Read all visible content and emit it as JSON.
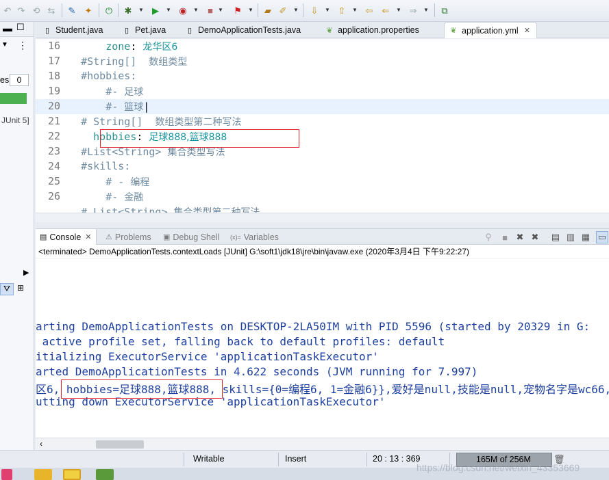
{
  "editor_tabs": [
    {
      "label": "Student.java",
      "icon": "java-file-icon",
      "active": false
    },
    {
      "label": "Pet.java",
      "icon": "java-file-icon",
      "active": false
    },
    {
      "label": "DemoApplicationTests.java",
      "icon": "java-file-icon",
      "active": false
    },
    {
      "label": "application.properties",
      "icon": "leaf-icon",
      "active": false
    },
    {
      "label": "application.yml",
      "icon": "leaf-icon",
      "active": true,
      "close": "✕"
    }
  ],
  "editor_lines": [
    {
      "num": "16",
      "indent": "      ",
      "parts": [
        {
          "t": "zone",
          "c": "k"
        },
        {
          "t": ": "
        },
        {
          "t": "龙华区6",
          "c": "v cjk"
        }
      ]
    },
    {
      "num": "17",
      "indent": "  ",
      "parts": [
        {
          "t": "#String[]  ",
          "c": "c"
        },
        {
          "t": "数组类型",
          "c": "c cjk"
        }
      ]
    },
    {
      "num": "18",
      "indent": "  ",
      "parts": [
        {
          "t": "#hobbies:",
          "c": "c"
        }
      ]
    },
    {
      "num": "19",
      "indent": "      ",
      "parts": [
        {
          "t": "#- ",
          "c": "c"
        },
        {
          "t": "足球",
          "c": "c cjk"
        }
      ]
    },
    {
      "num": "20",
      "indent": "      ",
      "parts": [
        {
          "t": "#- ",
          "c": "c"
        },
        {
          "t": "篮球",
          "c": "c cjk"
        },
        {
          "t": "|",
          "c": ""
        }
      ],
      "current": true
    },
    {
      "num": "21",
      "indent": "  ",
      "parts": [
        {
          "t": "# String[]  ",
          "c": "c"
        },
        {
          "t": "数组类型第二种写法",
          "c": "c cjk"
        }
      ]
    },
    {
      "num": "22",
      "indent": "    ",
      "parts": [
        {
          "t": "hobbies",
          "c": "k"
        },
        {
          "t": ": "
        },
        {
          "t": "足球888,篮球888",
          "c": "v cjk"
        }
      ]
    },
    {
      "num": "23",
      "indent": "  ",
      "parts": [
        {
          "t": "#List<String> ",
          "c": "c"
        },
        {
          "t": "集合类型写法",
          "c": "c cjk"
        }
      ]
    },
    {
      "num": "24",
      "indent": "  ",
      "parts": [
        {
          "t": "#skills:",
          "c": "c"
        }
      ]
    },
    {
      "num": "25",
      "indent": "      ",
      "parts": [
        {
          "t": "# - ",
          "c": "c"
        },
        {
          "t": "编程",
          "c": "c cjk"
        }
      ]
    },
    {
      "num": "26",
      "indent": "      ",
      "parts": [
        {
          "t": "#- ",
          "c": "c"
        },
        {
          "t": "金融",
          "c": "c cjk"
        }
      ]
    },
    {
      "num": "",
      "indent": "  ",
      "parts": [
        {
          "t": "# List<String> ",
          "c": "c"
        },
        {
          "t": "集合类型第二种写法",
          "c": "c cjk"
        }
      ]
    }
  ],
  "console_tabs": [
    {
      "label": "Console",
      "active": true,
      "icon": "console-icon",
      "close": "✕"
    },
    {
      "label": "Problems",
      "active": false,
      "icon": "problems-icon"
    },
    {
      "label": "Debug Shell",
      "active": false,
      "icon": "debug-shell-icon"
    },
    {
      "label": "Variables",
      "active": false,
      "icon": "variables-icon",
      "prefix": "(x)="
    }
  ],
  "console_status": "<terminated> DemoApplicationTests.contextLoads [JUnit] G:\\soft1\\jdk18\\jre\\bin\\javaw.exe (2020年3月4日 下午9:22:27)",
  "console_lines": [
    "arting DemoApplicationTests on DESKTOP-2LA50IM with PID 5596 (started by 20329 in G:",
    " active profile set, falling back to default profiles: default",
    "itializing ExecutorService 'applicationTaskExecutor'",
    "arted DemoApplicationTests in 4.622 seconds (JVM running for 7.997)",
    "区6, hobbies=足球888,篮球888, skills={0=编程6, 1=金融6}},爱好是null,技能是null,宠物名字是wc66,",
    "utting down ExecutorService 'applicationTaskExecutor'"
  ],
  "left_panel": {
    "label_es": "es:",
    "count": "0",
    "junit": "JUnit 5]"
  },
  "status_bar": {
    "mode": "Writable",
    "insert": "Insert",
    "position": "20 : 13 : 369",
    "heap": "165M of 256M"
  },
  "watermark": "https://blog.csdn.net/weixin_43353669",
  "colors": {
    "keyword": "#2a8f8f",
    "comment": "#6e8aa0",
    "console_text": "#1d3f9e",
    "highlight_box": "#e0202a",
    "progress": "#4caf50"
  }
}
